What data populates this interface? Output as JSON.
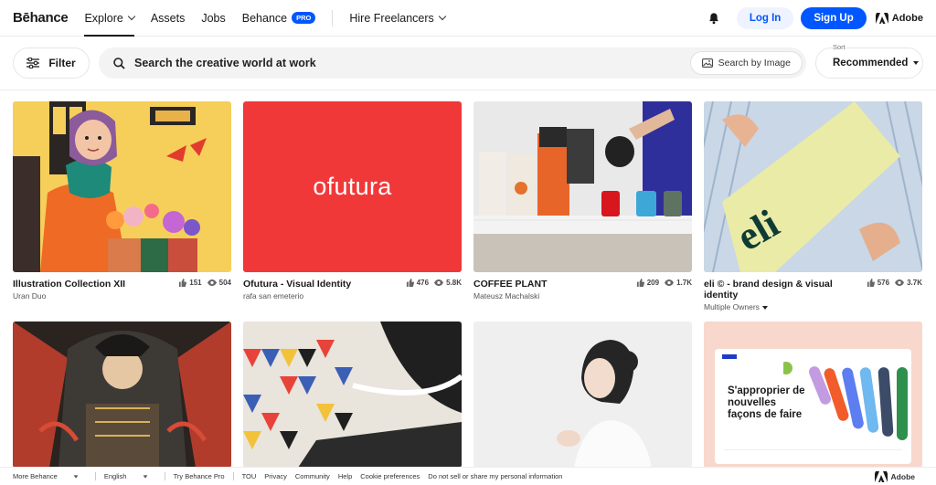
{
  "header": {
    "logo": "Bēhance",
    "nav": {
      "explore": "Explore",
      "assets": "Assets",
      "jobs": "Jobs",
      "behance_pro": "Behance",
      "pro_badge": "PRO",
      "hire": "Hire Freelancers"
    },
    "login": "Log In",
    "signup": "Sign Up",
    "adobe": "Adobe"
  },
  "toolbar": {
    "filter": "Filter",
    "search_placeholder": "Search the creative world at work",
    "search_by_image": "Search by Image",
    "sort_label": "Sort",
    "sort_value": "Recommended"
  },
  "projects": [
    {
      "title": "Illustration Collection XII",
      "owner": "Uran Duo",
      "likes": "151",
      "views": "504"
    },
    {
      "title": "Ofutura - Visual Identity",
      "owner": "rafa san emeterio",
      "likes": "476",
      "views": "5.8K",
      "thumb_text": "ofutura"
    },
    {
      "title": "COFFEE PLANT",
      "owner": "Mateusz Machalski",
      "likes": "209",
      "views": "1.7K"
    },
    {
      "title": "eli © - brand design & visual identity",
      "owner": "Multiple Owners",
      "likes": "576",
      "views": "3.7K",
      "thumb_text": "eli"
    }
  ],
  "row2": {
    "card4_heading": "S'approprier de nouvelles façons de faire"
  },
  "footer": {
    "more": "More Behance",
    "language": "English",
    "try_pro": "Try Behance Pro",
    "tou": "TOU",
    "privacy": "Privacy",
    "community": "Community",
    "help": "Help",
    "cookies": "Cookie preferences",
    "dnsell": "Do not sell or share my personal information",
    "adobe": "Adobe"
  },
  "colors": {
    "accent": "#0057ff",
    "ofutura_red": "#f13838"
  }
}
